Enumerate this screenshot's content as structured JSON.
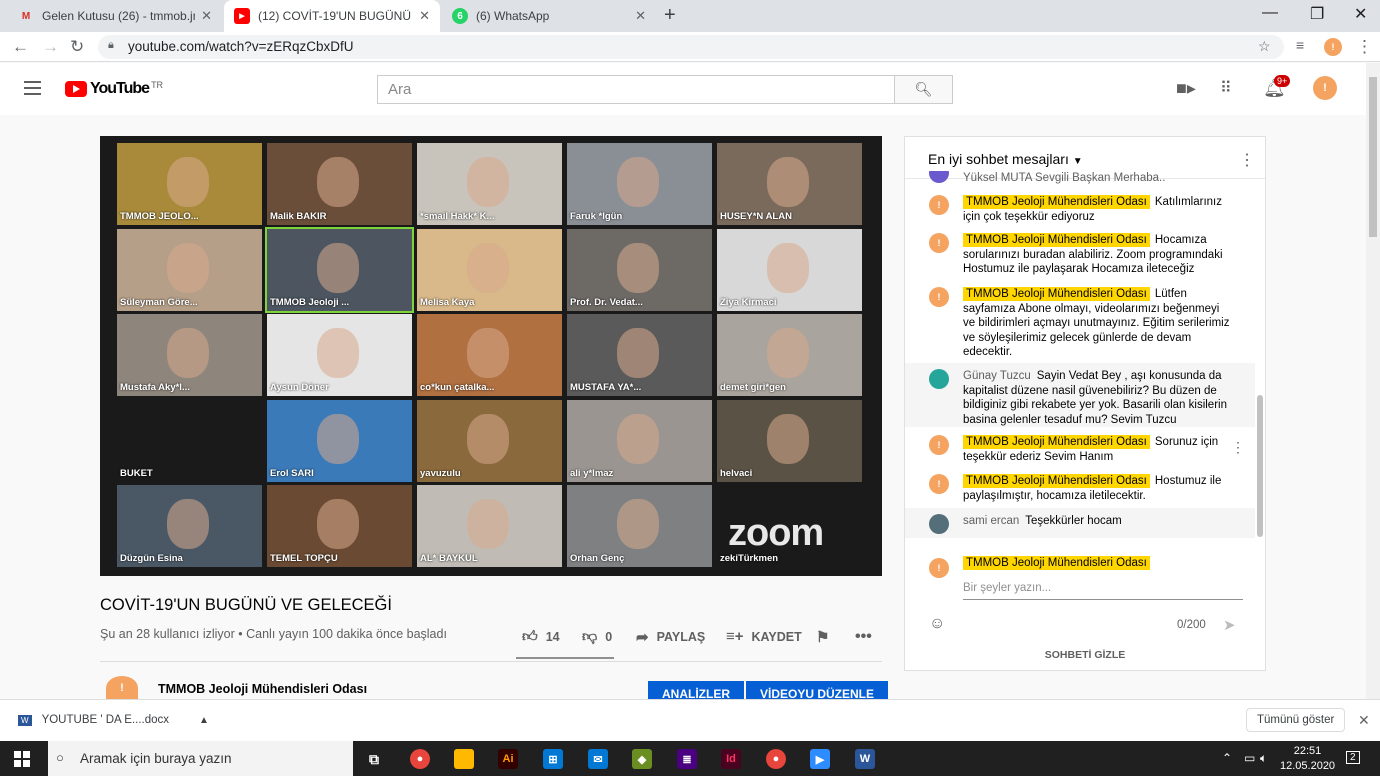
{
  "browser": {
    "tabs": [
      {
        "title": "Gelen Kutusu (26) - tmmob.jmo@",
        "icon": "gmail-icon"
      },
      {
        "title": "(12) COVİT-19'UN BUGÜNÜ VE G",
        "icon": "youtube-icon"
      },
      {
        "title": "(6) WhatsApp",
        "icon": "whatsapp-icon"
      }
    ],
    "url": "youtube.com/watch?v=zERqzCbxDfU"
  },
  "youtube": {
    "logo_text": "YouTube",
    "region": "TR",
    "search_placeholder": "Ara",
    "notification_count": "9+"
  },
  "video": {
    "title": "COVİT-19'UN BUGÜNÜ VE GELECEĞİ",
    "info": "Şu an 28 kullanıcı izliyor • Canlı yayın 100 dakika önce başladı",
    "likes": "14",
    "dislikes": "0",
    "share_label": "PAYLAŞ",
    "save_label": "KAYDET",
    "zoom_logo": "zoom",
    "participants": [
      {
        "name": "TMMOB JEOLO...",
        "bg": "#a88a3a"
      },
      {
        "name": "Malik BAKIR",
        "bg": "#6b4e3a"
      },
      {
        "name": "*smail Hakk* K...",
        "bg": "#c9c4bb"
      },
      {
        "name": "Faruk *lgün",
        "bg": "#8a8f96"
      },
      {
        "name": "HUSEY*N ALAN",
        "bg": "#7a6a5c"
      },
      {
        "name": "Süleyman Göre...",
        "bg": "#b59f88"
      },
      {
        "name": "TMMOB Jeoloji ...",
        "bg": "#4c5560"
      },
      {
        "name": "Melisa Kaya",
        "bg": "#d9b98a"
      },
      {
        "name": "Prof. Dr. Vedat...",
        "bg": "#6d6a66"
      },
      {
        "name": "Ziya Kirmaci",
        "bg": "#d8d8d8"
      },
      {
        "name": "Mustafa Aky*l...",
        "bg": "#8e857c"
      },
      {
        "name": "Aysun Döner",
        "bg": "#e5e5e5"
      },
      {
        "name": "co*kun çatalka...",
        "bg": "#b07040"
      },
      {
        "name": "MUSTAFA YA*...",
        "bg": "#5a5a5a"
      },
      {
        "name": "demet giri*gen",
        "bg": "#a9a49d"
      },
      {
        "name": "BUKET",
        "bg": "#1a1a1a"
      },
      {
        "name": "Erol SARI",
        "bg": "#3a7ab8"
      },
      {
        "name": "yavuzulu",
        "bg": "#8a6a3c"
      },
      {
        "name": "ali y*lmaz",
        "bg": "#9a9590"
      },
      {
        "name": "helvaci",
        "bg": "#5b5246"
      },
      {
        "name": "Düzgün Esina",
        "bg": "#4a5866"
      },
      {
        "name": "TEMEL TOPÇU",
        "bg": "#6a4a32"
      },
      {
        "name": "AL* BAYKUL",
        "bg": "#c0bcb5"
      },
      {
        "name": "Orhan Genç",
        "bg": "#7e8082"
      },
      {
        "name": "zekiTürkmen",
        "bg": "#1a1a1a"
      }
    ]
  },
  "channel": {
    "name": "TMMOB Jeoloji Mühendisleri Odası",
    "analytics_label": "ANALİZLER",
    "edit_label": "VİDEOYU DÜZENLE"
  },
  "chat": {
    "title": "En iyi sohbet mesajları",
    "partial_top": "Yüksel MUTA  Sevgili Başkan Merhaba..",
    "messages": [
      {
        "author": "TMMOB Jeoloji Mühendisleri Odası",
        "owner": true,
        "text": "Katılımlarınız için çok teşekkür ediyoruz"
      },
      {
        "author": "TMMOB Jeoloji Mühendisleri Odası",
        "owner": true,
        "text": "Hocamıza sorularınızı buradan alabiliriz. Zoom programındaki Hostumuz ile paylaşarak Hocamıza ileteceğiz"
      },
      {
        "author": "TMMOB Jeoloji Mühendisleri Odası",
        "owner": true,
        "text": "Lütfen sayfamıza Abone olmayı, videolarımızı beğenmeyi ve bildirimleri açmayı unutmayınız. Eğitim serilerimiz ve söyleşilerimiz gelecek günlerde de devam edecektir."
      },
      {
        "author": "Günay Tuzcu",
        "owner": false,
        "text": "Sayin Vedat Bey , aşı konusunda da kapitalist düzene nasil güvenebiliriz? Bu düzen de bildiginiz gibi rekabete yer yok. Basarili olan kisilerin basina gelenler tesaduf mu? Sevim Tuzcu"
      },
      {
        "author": "TMMOB Jeoloji Mühendisleri Odası",
        "owner": true,
        "text": "Sorunuz için teşekkür ederiz Sevim Hanım"
      },
      {
        "author": "TMMOB Jeoloji Mühendisleri Odası",
        "owner": true,
        "text": "Hostumuz ile paylaşılmıştır, hocamıza iletilecektir."
      },
      {
        "author": "sami ercan",
        "owner": false,
        "text": "Teşekkürler hocam"
      }
    ],
    "input_author": "TMMOB Jeoloji Mühendisleri Odası",
    "input_placeholder": "Bir şeyler yazın...",
    "counter": "0/200",
    "hide_label": "SOHBETİ GİZLE"
  },
  "download": {
    "file": "YOUTUBE ' DA E....docx",
    "show_all": "Tümünü göster"
  },
  "taskbar": {
    "search_placeholder": "Aramak için buraya yazın",
    "time": "22:51",
    "date": "12.05.2020",
    "notification_count": "2"
  }
}
